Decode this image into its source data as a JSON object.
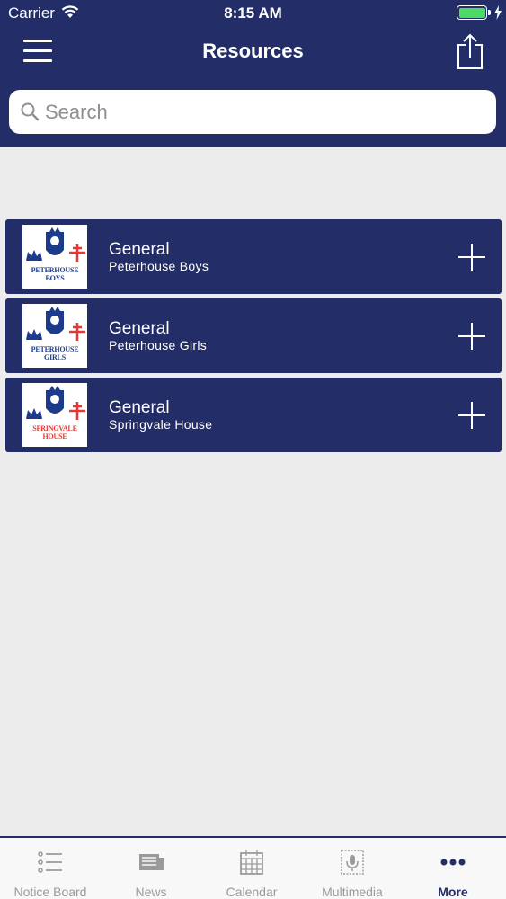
{
  "status_bar": {
    "carrier": "Carrier",
    "time": "8:15 AM"
  },
  "header": {
    "title": "Resources"
  },
  "search": {
    "placeholder": "Search",
    "value": ""
  },
  "resources": [
    {
      "title": "General",
      "subtitle": "Peterhouse Boys",
      "logo_text": [
        "PETERHOUSE",
        "BOYS"
      ],
      "logo_text_color": "#1e3a8a"
    },
    {
      "title": "General",
      "subtitle": "Peterhouse Girls",
      "logo_text": [
        "PETERHOUSE",
        "GIRLS"
      ],
      "logo_text_color": "#1e3a8a"
    },
    {
      "title": "General",
      "subtitle": "Springvale House",
      "logo_text": [
        "SPRINGVALE",
        "HOUSE"
      ],
      "logo_text_color": "#e53935"
    }
  ],
  "tabs": [
    {
      "label": "Notice Board",
      "icon": "list-icon",
      "active": false
    },
    {
      "label": "News",
      "icon": "newspaper-icon",
      "active": false
    },
    {
      "label": "Calendar",
      "icon": "calendar-icon",
      "active": false
    },
    {
      "label": "Multimedia",
      "icon": "microphone-icon",
      "active": false
    },
    {
      "label": "More",
      "icon": "more-icon",
      "active": true
    }
  ],
  "colors": {
    "brand": "#232d68",
    "background": "#ececec",
    "battery": "#4cd964"
  }
}
